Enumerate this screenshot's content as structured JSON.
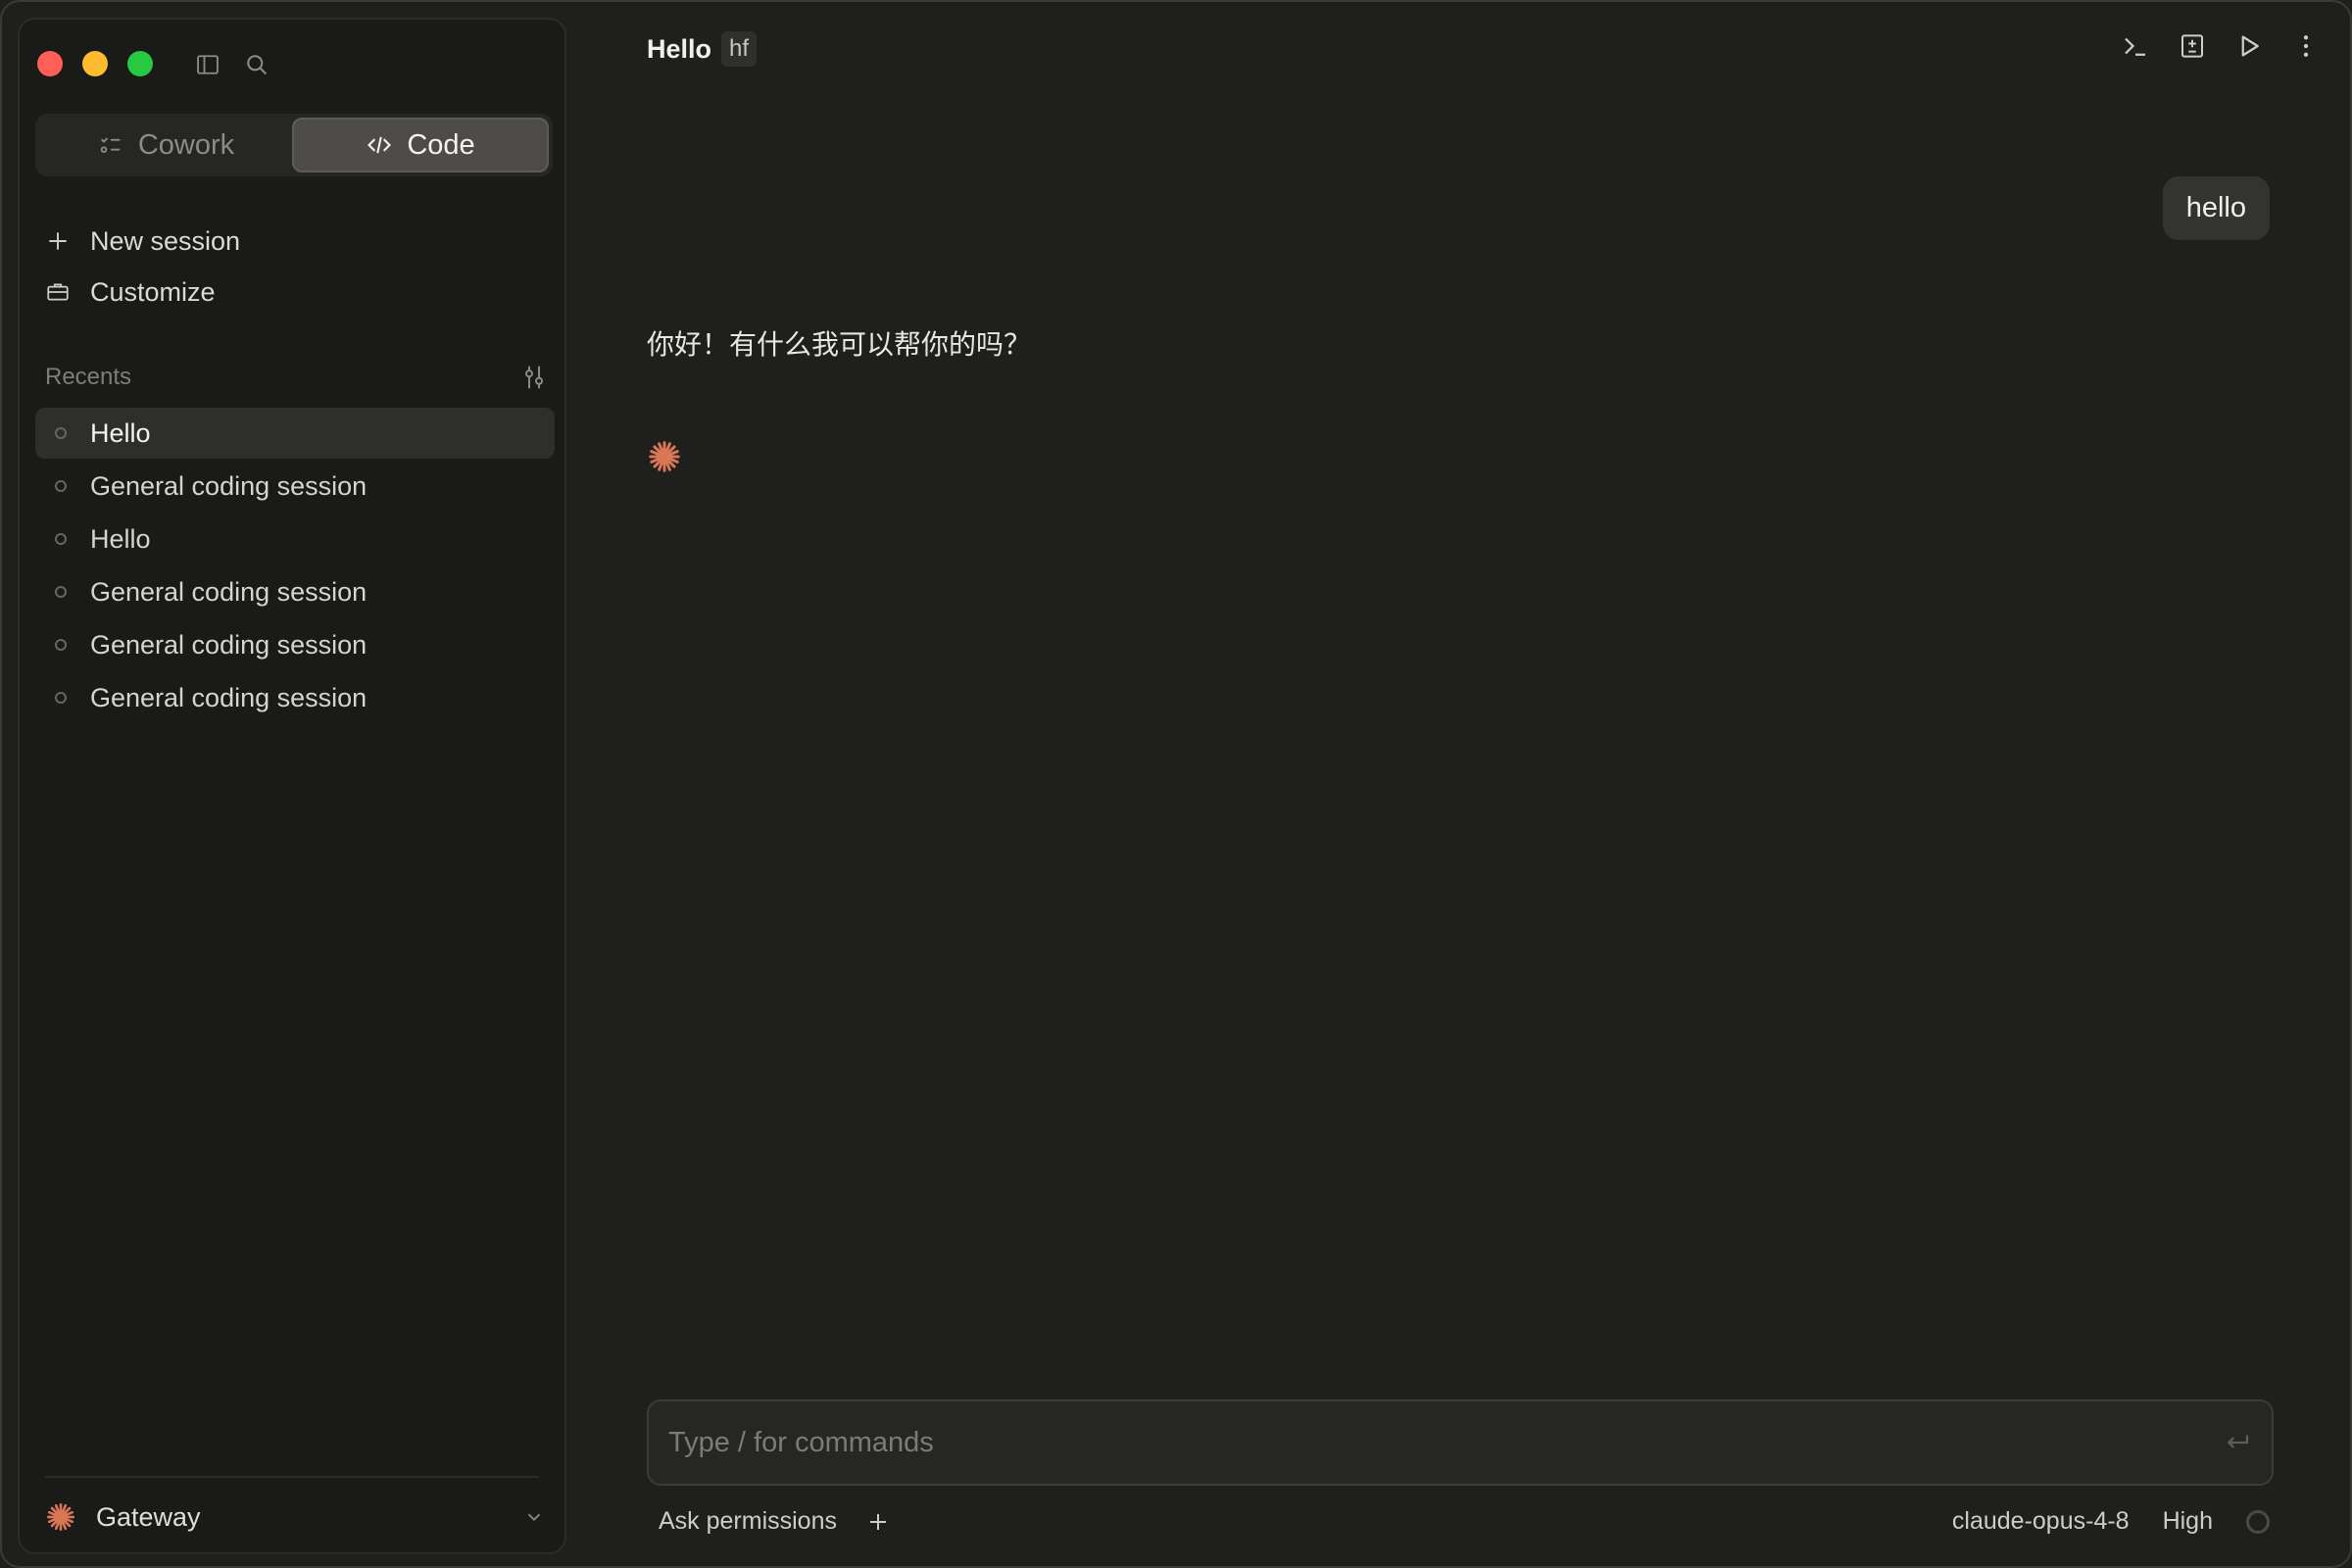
{
  "sidebar": {
    "modes": [
      {
        "label": "Cowork",
        "active": false
      },
      {
        "label": "Code",
        "active": true
      }
    ],
    "actions": {
      "new_session": "New session",
      "customize": "Customize"
    },
    "recents_title": "Recents",
    "recents": [
      {
        "label": "Hello",
        "active": true
      },
      {
        "label": "General coding session",
        "active": false
      },
      {
        "label": "Hello",
        "active": false
      },
      {
        "label": "General coding session",
        "active": false
      },
      {
        "label": "General coding session",
        "active": false
      },
      {
        "label": "General coding session",
        "active": false
      }
    ],
    "gateway": "Gateway"
  },
  "header": {
    "title": "Hello",
    "badge": "hf"
  },
  "conversation": {
    "user_message": "hello",
    "assistant_message": "你好！有什么我可以帮你的吗？"
  },
  "composer": {
    "placeholder": "Type / for commands",
    "permissions": "Ask permissions",
    "model": "claude-opus-4-8",
    "effort": "High"
  },
  "colors": {
    "accent": "#d97757",
    "traffic_red": "#ff5f57",
    "traffic_yellow": "#febc2e",
    "traffic_green": "#28c840"
  },
  "icons": {
    "sidebar_toggle": "sidebar-icon",
    "search": "search-icon",
    "terminal": "terminal-icon",
    "diff": "diff-icon",
    "run": "play-icon",
    "more": "more-vertical-icon"
  }
}
